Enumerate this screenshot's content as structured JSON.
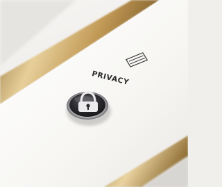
{
  "panel": {
    "label": "PRIVACY",
    "accent_gold": "#c9a55e",
    "panel_white": "#fbfaf8",
    "button_dark": "#2a2a2d",
    "icons": [
      "menu-lines-icon",
      "padlock-icon"
    ]
  }
}
